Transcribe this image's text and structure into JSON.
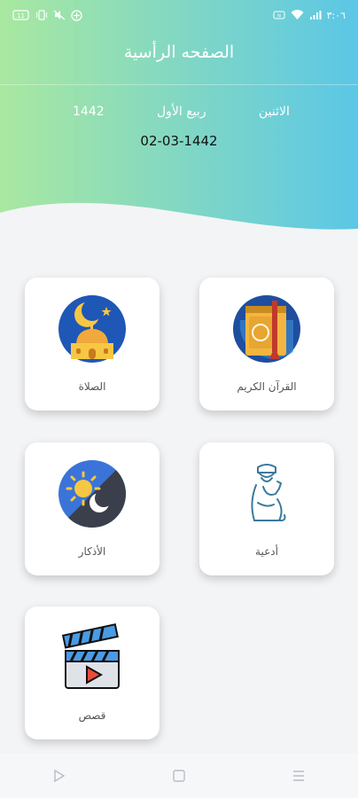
{
  "status_bar": {
    "left_icons": [
      "battery-saver-icon",
      "vibrate-icon",
      "mute-icon",
      "data-saver-icon"
    ],
    "battery_level": "11",
    "time": "٣:٠٦",
    "right_icons": [
      "nfc-icon",
      "wifi-icon",
      "signal-icon"
    ]
  },
  "header": {
    "title": "الصفحه الرأسية",
    "day_name": "الاثنين",
    "month_name": "ربيع الأول",
    "year": "1442",
    "hijri_date": "02-03-1442",
    "gradient_start": "#a8e6a3",
    "gradient_end": "#5ec6e3"
  },
  "cards": [
    {
      "label": "القرآن الكريم",
      "icon": "quran-book-icon"
    },
    {
      "label": "الصلاة",
      "icon": "mosque-crescent-icon"
    },
    {
      "label": "أدعية",
      "icon": "praying-man-icon"
    },
    {
      "label": "الأذكار",
      "icon": "day-night-icon"
    },
    {
      "label": "قصص",
      "icon": "clapperboard-icon"
    }
  ],
  "nav": {
    "back": "back-triangle-icon",
    "home": "home-square-icon",
    "menu": "menu-lines-icon"
  }
}
